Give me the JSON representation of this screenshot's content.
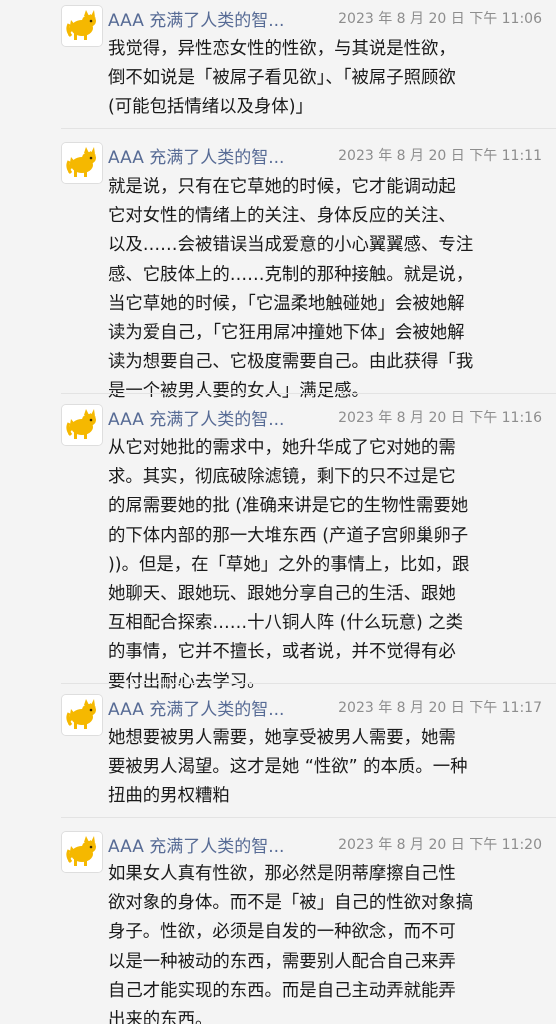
{
  "colors": {
    "background": "#f4f4f4",
    "sender_name": "#576b95",
    "timestamp": "#8d8d8d",
    "body_text": "#1a1a1a",
    "avatar_cat": "#f5b800"
  },
  "messages": [
    {
      "sender": "AAA 充满了人类的智...",
      "avatar_icon": "yellow-cat-icon",
      "time": "2023 年 8 月 20 日  下午 11:06",
      "text": "我觉得，异性恋女性的性欲，与其说是性欲，\n倒不如说是「被屌子看见欲」、「被屌子照顾欲\n(可能包括情绪以及身体)」"
    },
    {
      "sender": "AAA 充满了人类的智...",
      "avatar_icon": "yellow-cat-icon",
      "time": "2023 年 8 月 20 日  下午 11:11",
      "text": "就是说，只有在它草她的时候，它才能调动起\n它对女性的情绪上的关注、身体反应的关注、\n以及……会被错误当成爱意的小心翼翼感、专注\n感、它肢体上的……克制的那种接触。就是说，\n当它草她的时候，「它温柔地触碰她」会被她解\n读为爱自己，「它狂用屌冲撞她下体」会被她解\n读为想要自己、它极度需要自己。由此获得「我\n是一个被男人要的女人」满足感。"
    },
    {
      "sender": "AAA 充满了人类的智...",
      "avatar_icon": "yellow-cat-icon",
      "time": "2023 年 8 月 20 日  下午 11:16",
      "text": "从它对她批的需求中，她升华成了它对她的需\n求。其实，彻底破除滤镜，剩下的只不过是它\n的屌需要她的批 (准确来讲是它的生物性需要她\n的下体内部的那一大堆东西 (产道子宫卵巢卵子\n))。但是，在「草她」之外的事情上，比如，跟\n她聊天、跟她玩、跟她分享自己的生活、跟她\n互相配合探索……十八铜人阵 (什么玩意) 之类\n的事情，它并不擅长，或者说，并不觉得有必\n要付出耐心去学习。"
    },
    {
      "sender": "AAA 充满了人类的智...",
      "avatar_icon": "yellow-cat-icon",
      "time": "2023 年 8 月 20 日  下午 11:17",
      "text": "她想要被男人需要，她享受被男人需要，她需\n要被男人渴望。这才是她 “性欲” 的本质。一种\n扭曲的男权糟粕"
    },
    {
      "sender": "AAA 充满了人类的智...",
      "avatar_icon": "yellow-cat-icon",
      "time": "2023 年 8 月 20 日  下午 11:20",
      "text": "如果女人真有性欲，那必然是阴蒂摩擦自己性\n欲对象的身体。而不是「被」自己的性欲对象搞\n身子。性欲，必须是自发的一种欲念，而不可\n以是一种被动的东西，需要别人配合自己来弄\n自己才能实现的东西。而是自己主动弄就能弄\n出来的东西。"
    }
  ]
}
